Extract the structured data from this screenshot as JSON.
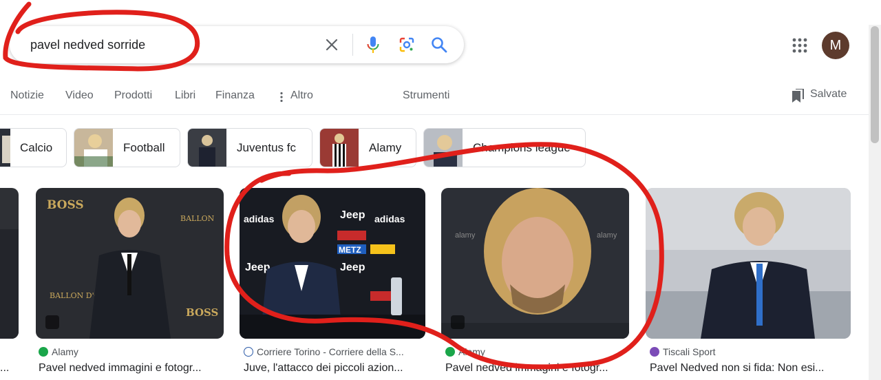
{
  "search": {
    "query": "pavel nedved sorride"
  },
  "header": {
    "avatar_letter": "M"
  },
  "tabs": [
    {
      "label": "Notizie"
    },
    {
      "label": "Video"
    },
    {
      "label": "Prodotti"
    },
    {
      "label": "Libri"
    },
    {
      "label": "Finanza"
    },
    {
      "label": "Altro"
    },
    {
      "label": "Strumenti"
    }
  ],
  "saved": {
    "label": "Salvate"
  },
  "chips": [
    {
      "label": "Calcio"
    },
    {
      "label": "Football"
    },
    {
      "label": "Juventus fc"
    },
    {
      "label": "Alamy"
    },
    {
      "label": "Champions league"
    }
  ],
  "results": [
    {
      "source": "",
      "title": "..."
    },
    {
      "source": "Alamy",
      "title": "Pavel nedved immagini e fotogr..."
    },
    {
      "source": "Corriere Torino - Corriere della S...",
      "title": "Juve, l'attacco dei piccoli azion..."
    },
    {
      "source": "Alamy",
      "title": "Pavel nedved immagini e fotogr..."
    },
    {
      "source": "Tiscali Sport",
      "title": "Pavel Nedved non si fida: Non esi..."
    }
  ],
  "colors": {
    "annotation": "#e0201b",
    "google_blue": "#4285f4",
    "google_red": "#ea4335",
    "google_yellow": "#fbbc05",
    "google_green": "#34a853",
    "alamy_green": "#1aa64a",
    "tiscali_purple": "#7b4bb7"
  },
  "icons": {
    "clear": "close-icon",
    "voice": "microphone-icon",
    "lens": "camera-lens-icon",
    "search": "search-icon",
    "apps": "apps-grid-icon",
    "saved": "bookmark-icon",
    "more": "more-vert-icon",
    "badge": "image-icon"
  }
}
